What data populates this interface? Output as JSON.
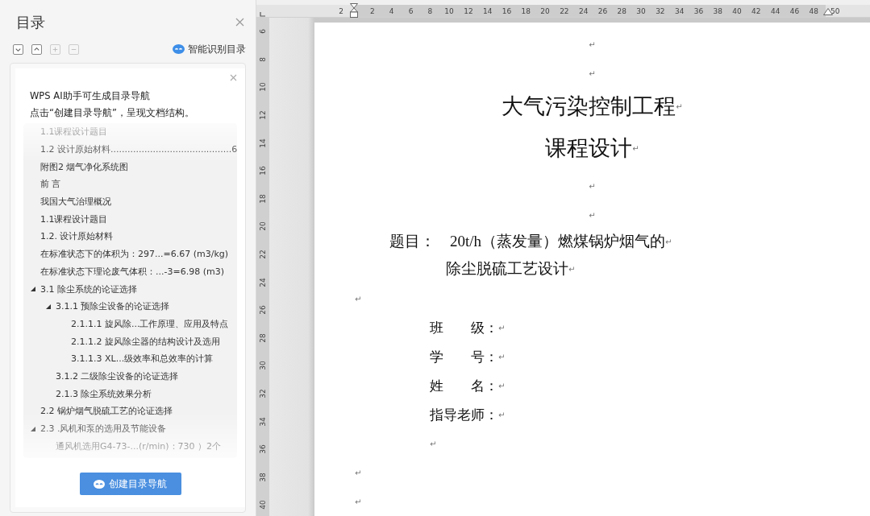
{
  "sidebar": {
    "title": "目录",
    "toolbar": [
      {
        "kind": "expand",
        "disabled": false
      },
      {
        "kind": "collapse",
        "disabled": false
      },
      {
        "kind": "plus",
        "disabled": true
      },
      {
        "kind": "minus",
        "disabled": true
      }
    ],
    "smart_toc": "智能识别目录",
    "ai_card": {
      "lines": [
        "WPS AI助手可生成目录导航",
        "点击“创建目录导航”，呈现文档结构。"
      ],
      "preview": [
        {
          "label": "1.1课程设计题目"
        },
        {
          "label": "1.2 设计原始材料...........................................6"
        },
        {
          "label": "附图2 烟气净化系统图"
        },
        {
          "label": "前 言"
        },
        {
          "label": "我国大气治理概况"
        },
        {
          "label": "1.1课程设计题目"
        },
        {
          "label": "1.2. 设计原始材料"
        },
        {
          "label": "在标准状态下的体积为：297...=6.67 (m3/kg)"
        },
        {
          "label": "在标准状态下理论废气体积：...-3=6.98 (m3)"
        },
        {
          "label": "3.1 除尘系统的论证选择",
          "expanded": true,
          "children": [
            {
              "label": "3.1.1 预除尘设备的论证选择",
              "expanded": true,
              "children": [
                {
                  "label": "2.1.1.1 旋风除...工作原理、应用及特点"
                },
                {
                  "label": "2.1.1.2 旋风除尘器的结构设计及选用"
                },
                {
                  "label": "3.1.1.3  XL...级效率和总效率的计算"
                }
              ]
            },
            {
              "label": "3.1.2 二级除尘设备的论证选择"
            },
            {
              "label": "2.1.3  除尘系统效果分析"
            }
          ]
        },
        {
          "label": "2.2 锅炉烟气脱硫工艺的论证选择"
        },
        {
          "label": "2.3  .风机和泵的选用及节能设备",
          "expanded": true,
          "children": [
            {
              "label": "通风机选用G4-73-...(r/min)：730 ）2个"
            }
          ]
        }
      ],
      "button": "创建目录导航"
    }
  },
  "ruler": {
    "left_labels": [
      "2"
    ],
    "labels": [
      "2",
      "4",
      "6",
      "8",
      "10",
      "12",
      "14",
      "16",
      "18",
      "20",
      "22",
      "24",
      "26",
      "28",
      "30",
      "32",
      "34",
      "36",
      "38",
      "40",
      "42",
      "44",
      "46",
      "48"
    ],
    "right_labels": [
      "50"
    ]
  },
  "vertical_ruler": [
    "6",
    "8",
    "10",
    "12",
    "14",
    "16",
    "18",
    "20",
    "22",
    "24",
    "26",
    "28",
    "30",
    "32",
    "34",
    "36",
    "38",
    "40"
  ],
  "document": [
    {
      "kind": "blank-center",
      "mark": "↵"
    },
    {
      "kind": "blank-center",
      "mark": "↵"
    },
    {
      "kind": "title",
      "text": "大气污染控制工程",
      "mark": "↵"
    },
    {
      "kind": "subtitle",
      "text": "课程设计",
      "mark": "↵"
    },
    {
      "kind": "blank-center",
      "mark": "↵"
    },
    {
      "kind": "blank-center",
      "mark": "↵"
    },
    {
      "kind": "topic",
      "label": "题目：",
      "text": "20t/h（蒸发量）燃煤锅炉烟气的",
      "mark": "↵"
    },
    {
      "kind": "topic-cont",
      "text": "除尘脱硫工艺设计",
      "mark": "↵"
    },
    {
      "kind": "blank-left",
      "mark": "↵"
    },
    {
      "kind": "field",
      "text": "班　　级：",
      "mark": "↵"
    },
    {
      "kind": "field",
      "text": "学　　号：",
      "mark": "↵"
    },
    {
      "kind": "field",
      "text": "姓　　名：",
      "mark": "↵"
    },
    {
      "kind": "field",
      "text": "指导老师：",
      "mark": "↵"
    },
    {
      "kind": "blank-field",
      "mark": "↵"
    },
    {
      "kind": "blank-left",
      "mark": "↵"
    },
    {
      "kind": "blank-left",
      "mark": "↵"
    }
  ]
}
